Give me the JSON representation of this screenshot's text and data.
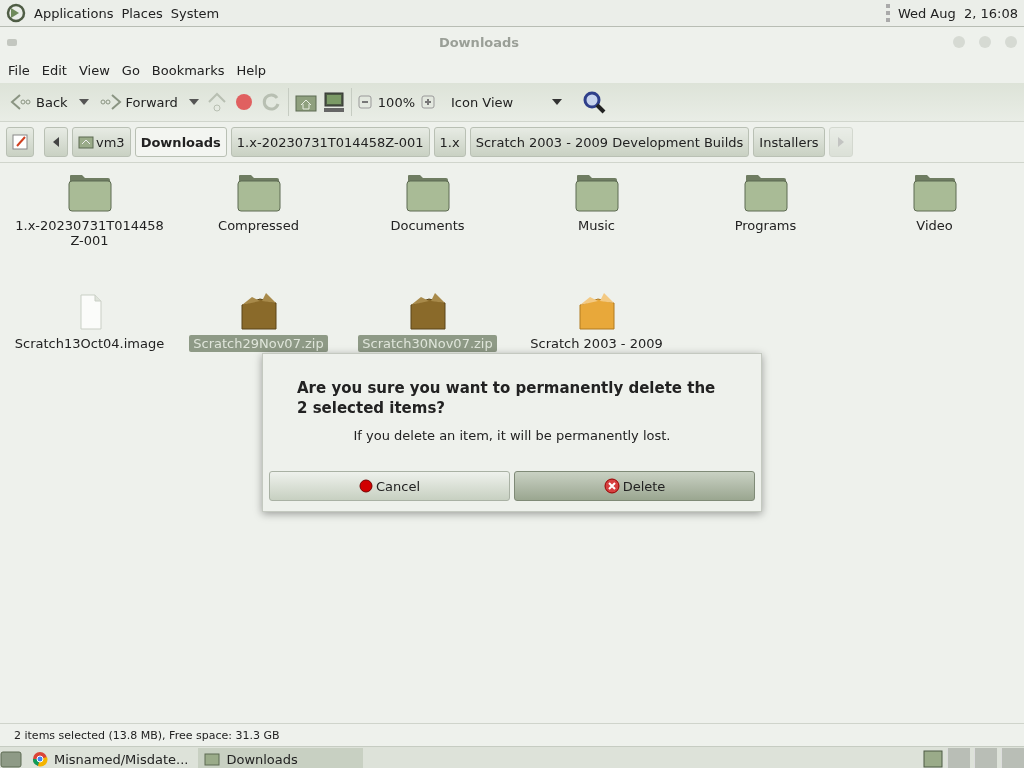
{
  "top_panel": {
    "menus": [
      "Applications",
      "Places",
      "System"
    ],
    "clock": "Wed Aug  2, 16:08"
  },
  "window": {
    "title": "Downloads"
  },
  "menubar": [
    "File",
    "Edit",
    "View",
    "Go",
    "Bookmarks",
    "Help"
  ],
  "toolbar": {
    "back": "Back",
    "forward": "Forward",
    "zoom": "100%",
    "view": "Icon View"
  },
  "location": {
    "crumbs": [
      {
        "label": "vm3",
        "selected": false,
        "home": true
      },
      {
        "label": "Downloads",
        "selected": true,
        "home": false
      },
      {
        "label": "1.x-20230731T014458Z-001",
        "selected": false,
        "home": false
      },
      {
        "label": "1.x",
        "selected": false,
        "home": false
      },
      {
        "label": "Scratch 2003 - 2009 Development Builds",
        "selected": false,
        "home": false
      },
      {
        "label": "Installers",
        "selected": false,
        "home": false
      }
    ]
  },
  "files": [
    {
      "kind": "folder",
      "name": "1.x-20230731T014458Z-001",
      "selected": false
    },
    {
      "kind": "folder",
      "name": "Compressed",
      "selected": false
    },
    {
      "kind": "folder",
      "name": "Documents",
      "selected": false
    },
    {
      "kind": "folder",
      "name": "Music",
      "selected": false
    },
    {
      "kind": "folder",
      "name": "Programs",
      "selected": false
    },
    {
      "kind": "folder",
      "name": "Video",
      "selected": false
    },
    {
      "kind": "image",
      "name": "Scratch13Oct04.image",
      "selected": false
    },
    {
      "kind": "archive",
      "name": "Scratch29Nov07.zip",
      "selected": true
    },
    {
      "kind": "archive",
      "name": "Scratch30Nov07.zip",
      "selected": true
    },
    {
      "kind": "archive",
      "name": "Scratch 2003 - 2009",
      "selected": false
    }
  ],
  "dialog": {
    "heading": "Are you sure you want to permanently delete the 2 selected items?",
    "message": "If you delete an item, it will be permanently lost.",
    "buttons": [
      {
        "kind": "cancel",
        "label": "Cancel",
        "selected": false
      },
      {
        "kind": "delete",
        "label": "Delete",
        "selected": true
      }
    ]
  },
  "status_bar": "2 items selected (13.8 MB), Free space: 31.3 GB",
  "taskbar": {
    "tasks": [
      {
        "kind": "browser",
        "label": "Misnamed/Misdate...",
        "selected": false
      },
      {
        "kind": "folder",
        "label": "Downloads",
        "selected": true
      }
    ]
  }
}
